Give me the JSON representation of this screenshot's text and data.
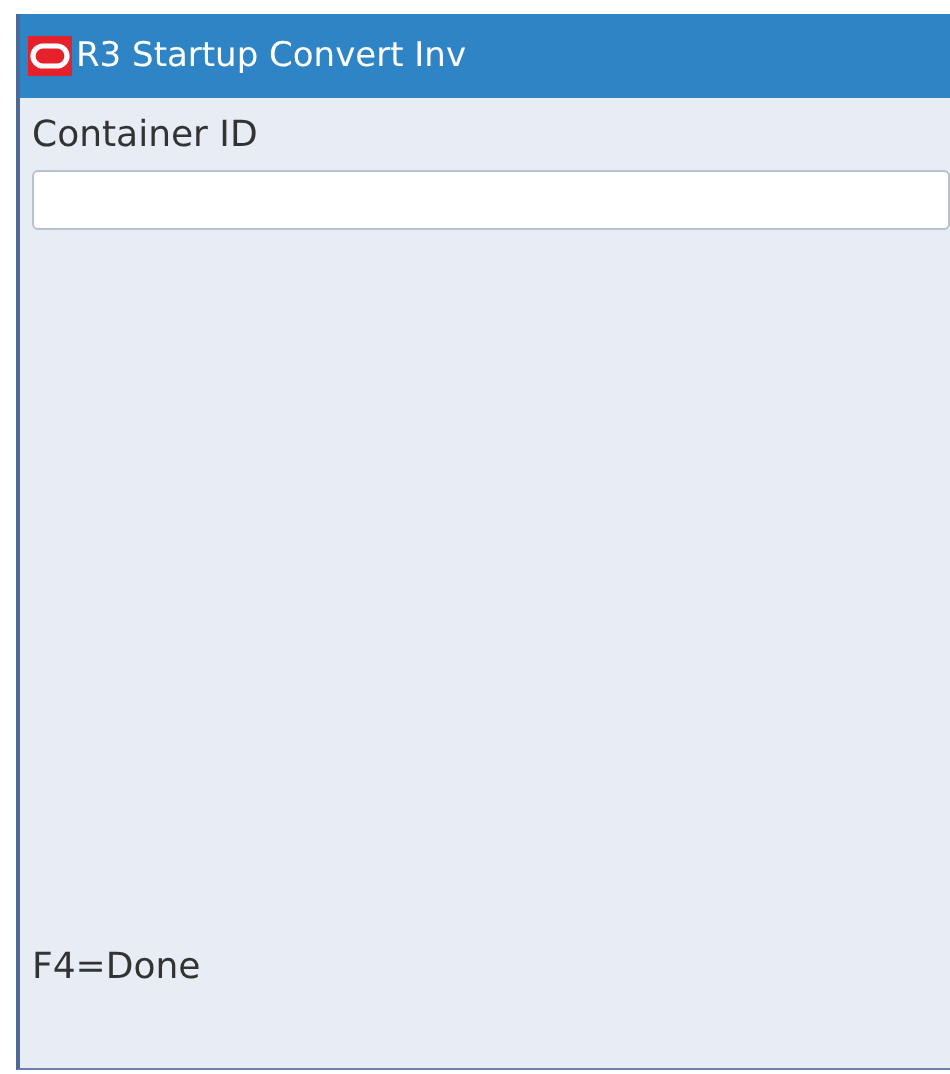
{
  "window": {
    "title": "R3 Startup Convert Inv"
  },
  "field": {
    "label": "Container ID"
  },
  "footer": "F4=Done"
}
